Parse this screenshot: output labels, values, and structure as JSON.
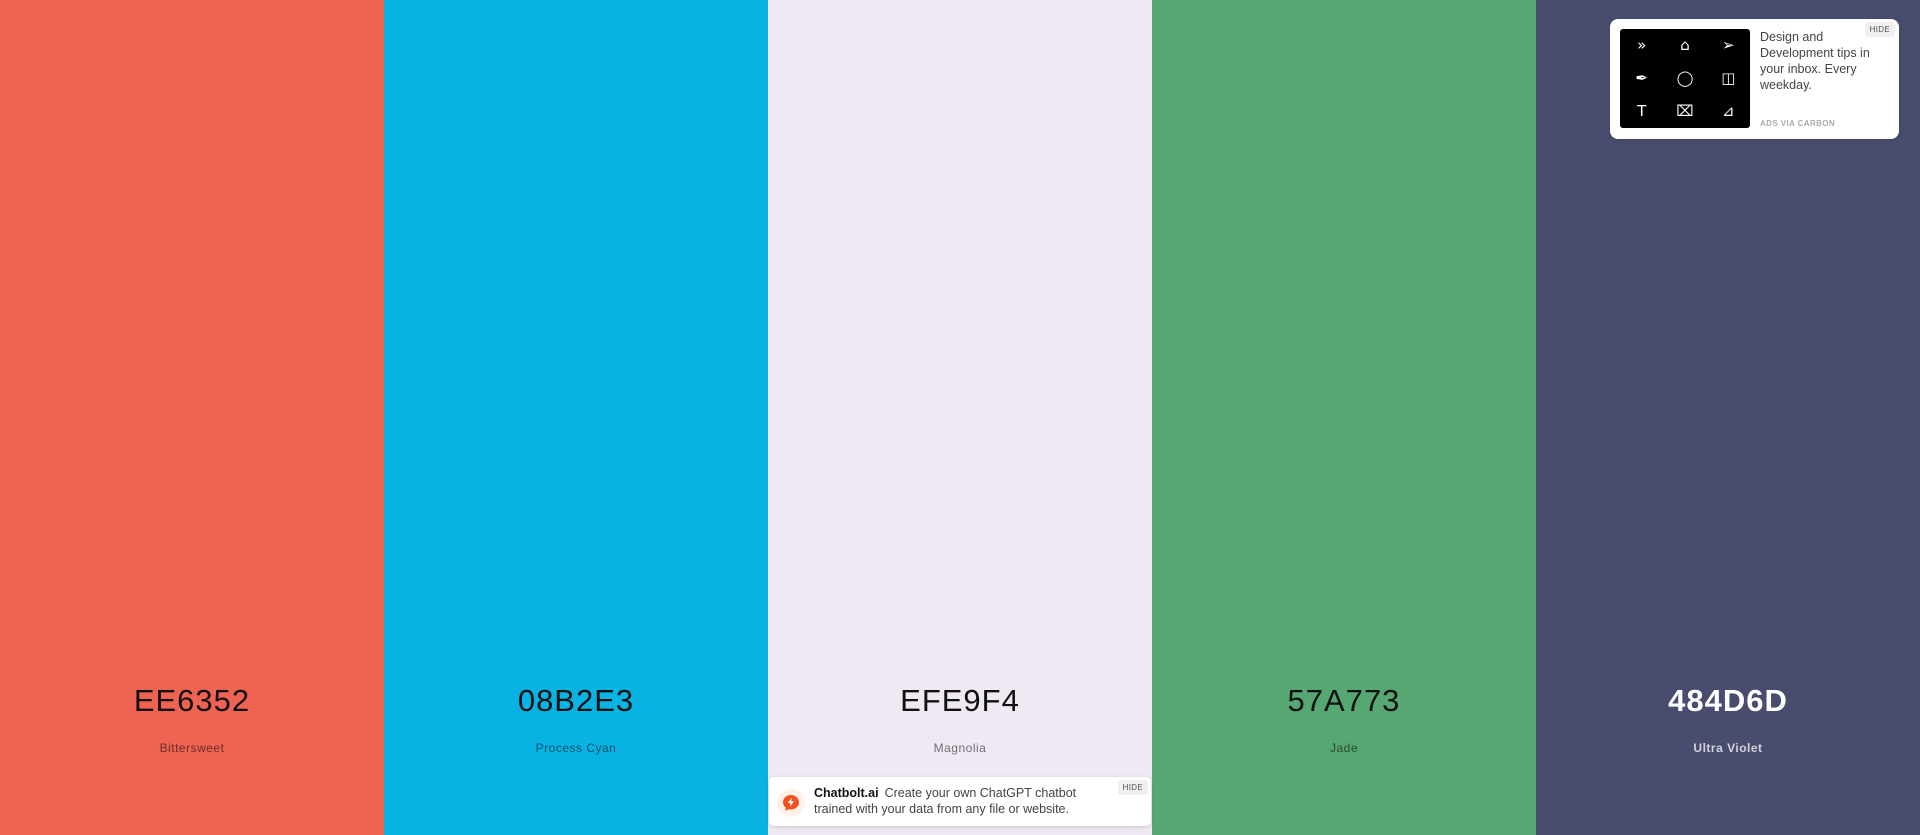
{
  "palette": [
    {
      "hex": "EE6352",
      "name": "Bittersweet",
      "color": "#EE6352",
      "text_theme": "dark"
    },
    {
      "hex": "08B2E3",
      "name": "Process Cyan",
      "color": "#08B2E3",
      "text_theme": "dark"
    },
    {
      "hex": "EFE9F4",
      "name": "Magnolia",
      "color": "#EFE9F4",
      "text_theme": "dark"
    },
    {
      "hex": "57A773",
      "name": "Jade",
      "color": "#57A773",
      "text_theme": "dark"
    },
    {
      "hex": "484D6D",
      "name": "Ultra Violet",
      "color": "#484D6D",
      "text_theme": "light"
    }
  ],
  "carbon_ad": {
    "text": "Design and Development tips in your inbox. Every weekday.",
    "via": "ADS VIA CARBON",
    "hide_label": "HIDE",
    "thumb_icons": [
      "chevrons-right-icon",
      "home-icon",
      "cursor-plus-icon",
      "pen-tool-icon",
      "lasso-icon",
      "file-cursor-icon",
      "text-tool-icon",
      "frame-tool-icon",
      "line-tool-icon"
    ]
  },
  "chatbolt_ad": {
    "brand": "Chatbolt.ai",
    "text": "Create your own ChatGPT chatbot trained with your data from any file or website.",
    "hide_label": "HIDE",
    "logo_color": "#F4511E"
  }
}
